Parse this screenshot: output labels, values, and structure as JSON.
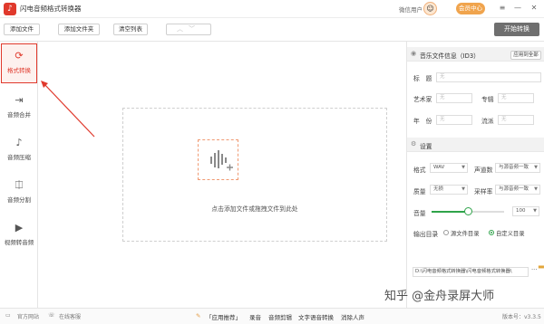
{
  "titlebar": {
    "title": "闪电音频格式转换器",
    "wx_user": "微信用户",
    "avatar_glyph": "☺",
    "vip_label": "会员中心",
    "menu_glyph": "≡",
    "minimize_glyph": "—",
    "close_glyph": "✕"
  },
  "toolbar": {
    "add_file": "添加文件",
    "add_folder": "添加文件夹",
    "clear_list": "清空列表",
    "start": "开始转换"
  },
  "sidebar": {
    "items": [
      {
        "label": "格式转换",
        "glyph": "⟳"
      },
      {
        "label": "音频合并",
        "glyph": "⇥"
      },
      {
        "label": "音频压缩",
        "glyph": "♪"
      },
      {
        "label": "音频分割",
        "glyph": "⎅"
      },
      {
        "label": "视频转音频",
        "glyph": "▶"
      }
    ]
  },
  "dropzone": {
    "text": "点击添加文件或拖拽文件到此处"
  },
  "id3": {
    "title": "音乐文件信息（ID3）",
    "apply_all": "应用到全部",
    "title_label": "标　题",
    "artist_label": "艺术家",
    "album_label": "专辑",
    "year_label": "年　份",
    "genre_label": "流派",
    "placeholder": "无"
  },
  "settings": {
    "title": "设置",
    "format_label": "格式",
    "format_value": "WAV",
    "channel_label": "声道数",
    "channel_value": "与源音频一致",
    "quality_label": "质量",
    "quality_value": "无损",
    "samplerate_label": "采样率",
    "samplerate_value": "与源音频一致",
    "volume_label": "音量",
    "volume_value": "100",
    "volume_fraction": 0.5,
    "output_label": "输出目录",
    "output_source": "源文件目录",
    "output_custom": "自定义目录",
    "output_path": "D:\\闪电音频格式转换器\\闪电音频格式转换器\\"
  },
  "bottombar": {
    "website": "官方网站",
    "service": "在线客服",
    "recommend": "「应用推荐」",
    "record": "录音",
    "cut": "音频剪辑",
    "tts": "文字语音转换",
    "vocal": "消除人声",
    "version": "版本号：v3.3.5"
  },
  "watermark": "知乎 @金舟录屏大师",
  "colors": {
    "accent": "#e0392c",
    "vip": "#f0a44d",
    "green": "#2fa34a"
  }
}
